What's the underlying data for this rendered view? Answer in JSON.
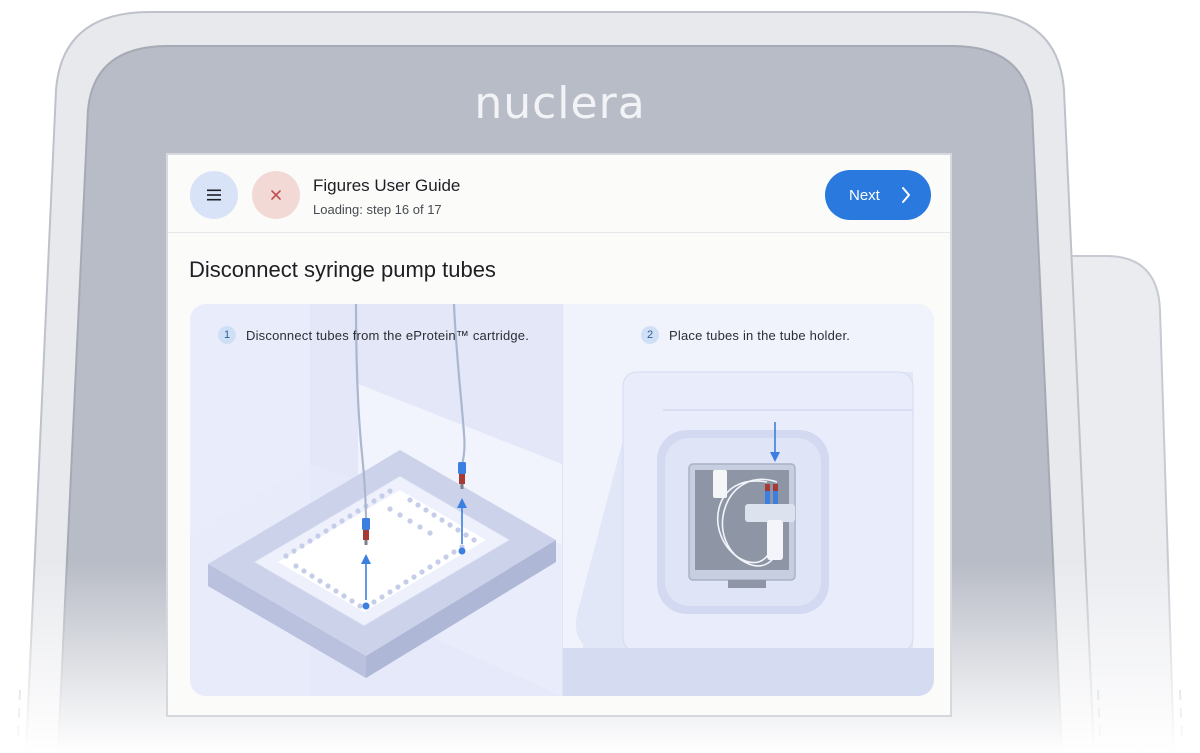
{
  "brand": {
    "name": "nuclera"
  },
  "header": {
    "menu_icon": "hamburger-menu-icon",
    "close_icon": "close-x-icon",
    "title": "Figures User Guide",
    "status": "Loading: step 16 of 17",
    "next_label": "Next",
    "next_icon": "chevron-right-icon"
  },
  "step": {
    "heading": "Disconnect syringe pump tubes",
    "instructions": [
      {
        "number": "1",
        "text": "Disconnect tubes from the eProtein™ cartridge."
      },
      {
        "number": "2",
        "text": "Place tubes in the tube holder."
      }
    ]
  },
  "colors": {
    "accent": "#2a79de",
    "menu_button": "#d8e3f7",
    "close_button": "#f3d9d6",
    "close_icon": "#c0504d",
    "illustration_blue": "#3b7fe0",
    "illustration_red": "#a83a36"
  }
}
